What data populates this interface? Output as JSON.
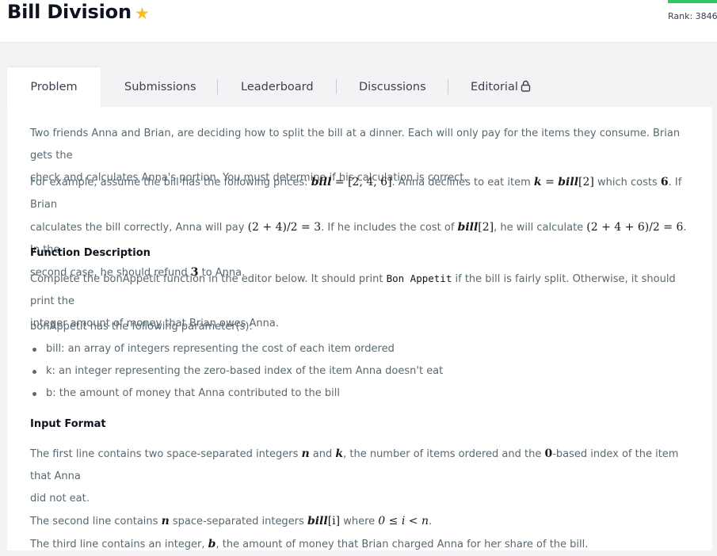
{
  "header": {
    "title": "Bill Division",
    "rank_label": "Rank: 3846"
  },
  "tabs": [
    {
      "label": "Problem"
    },
    {
      "label": "Submissions"
    },
    {
      "label": "Leaderboard"
    },
    {
      "label": "Discussions"
    },
    {
      "label": "Editorial"
    }
  ],
  "problem": {
    "intro_line1": "Two friends Anna and Brian, are deciding how to split the bill at a dinner. Each will only pay for the items they consume. Brian gets the",
    "intro_line2": "check and calculates Anna's portion. You must determine if his calculation is correct.",
    "example": {
      "t1": "For example, assume the bill has the following prices: ",
      "m1a": "bill",
      "m1b": " = [2, 4, 6]",
      "t2": ". Anna declines to eat item ",
      "m2a": "k",
      "m2b": " = ",
      "m2c": "bill",
      "m2d": "[2]",
      "t3": " which costs ",
      "m3": "6",
      "t4": ". If Brian",
      "t5": "calculates the bill correctly, Anna will pay ",
      "m4": "(2 + 4)/2 = 3",
      "t6": ". If he includes the cost of ",
      "m5a": "bill",
      "m5b": "[2]",
      "t7": ", he will calculate ",
      "m6": "(2 + 4 + 6)/2 = 6",
      "t8": ". In the",
      "t9": "second case, he should refund ",
      "m7": "3",
      "t10": " to Anna."
    },
    "function_heading": "Function Description",
    "func_t1": "Complete the bonAppetit function in the editor below. It should print ",
    "func_code": "Bon Appetit",
    "func_t2": " if the bill is fairly split. Otherwise, it should print the",
    "func_t3": "integer amount of money that Brian owes Anna.",
    "params_intro": "bonAppetit has the following parameter(s):",
    "params": [
      "bill: an array of integers representing the cost of each item ordered",
      "k: an integer representing the zero-based index of the item Anna doesn't eat",
      "b: the amount of money that Anna contributed to the bill"
    ],
    "input_heading": "Input Format",
    "input": {
      "a1": "The first line contains two space-separated integers ",
      "n1": "n",
      "a2": " and ",
      "k1": "k",
      "a3": ", the number of items ordered and the ",
      "z1": "0",
      "a4": "-based index of the item that Anna",
      "a5": "did not eat.",
      "b1": "The second line contains ",
      "n2": "n",
      "b2": " space-separated integers ",
      "bi": "bill",
      "bi2": "[i]",
      "b3": " where ",
      "cond": "0 ≤ i < n",
      "b4": ".",
      "c1": "The third line contains an integer, ",
      "bvar": "b",
      "c2": ", the amount of money that Brian charged Anna for her share of the bill."
    }
  }
}
